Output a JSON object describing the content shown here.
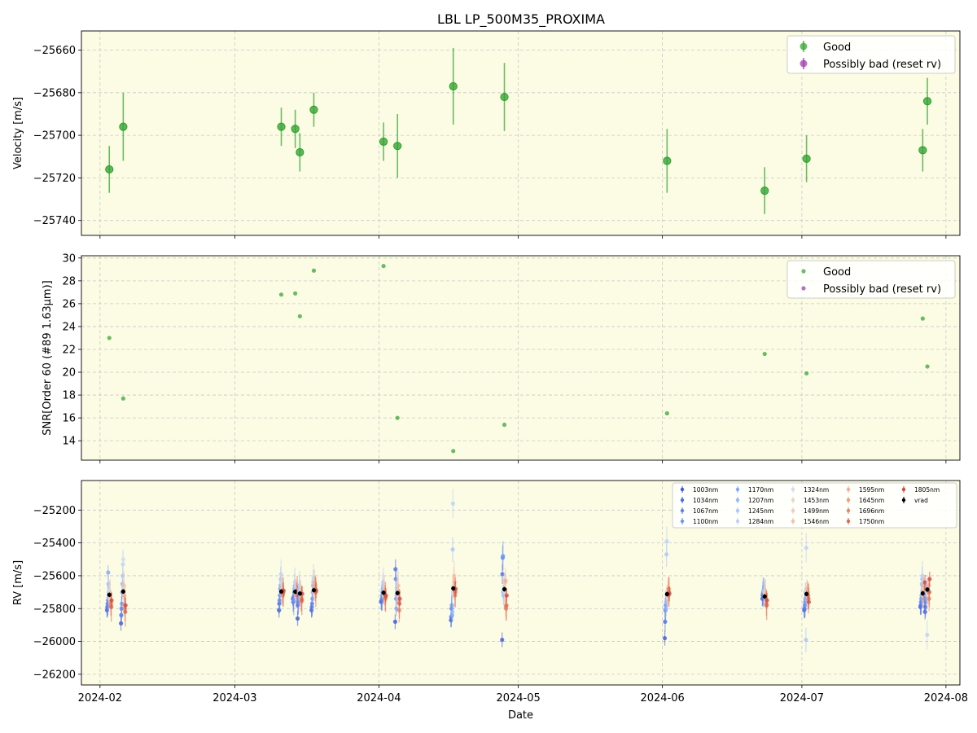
{
  "title": "LBL LP_500M35_PROXIMA",
  "colors": {
    "good": "#2ca02c",
    "bad": "#9b30b0",
    "panel_bg": "#fcfce4",
    "grid": "#c8c8c8"
  },
  "chart_data": [
    {
      "type": "scatter",
      "panel": "velocity",
      "ylabel": "Velocity [m/s]",
      "ylim": [
        -25747,
        -25651
      ],
      "yticks": [
        -25660,
        -25680,
        -25700,
        -25720,
        -25740
      ],
      "ytick_labels": [
        "−25660",
        "−25680",
        "−25700",
        "−25720",
        "−25740"
      ],
      "legend": [
        "Good",
        "Possibly bad (reset rv)"
      ],
      "legend_position": "top-right",
      "grid": true,
      "series": [
        {
          "name": "Good",
          "points": [
            {
              "x": "2024-02-03",
              "y": -25716,
              "err": 11
            },
            {
              "x": "2024-02-06",
              "y": -25696,
              "err": 16
            },
            {
              "x": "2024-03-11",
              "y": -25696,
              "err": 9
            },
            {
              "x": "2024-03-14",
              "y": -25697,
              "err": 9
            },
            {
              "x": "2024-03-15",
              "y": -25708,
              "err": 9
            },
            {
              "x": "2024-03-18",
              "y": -25688,
              "err": 8
            },
            {
              "x": "2024-04-02",
              "y": -25703,
              "err": 9
            },
            {
              "x": "2024-04-05",
              "y": -25705,
              "err": 15
            },
            {
              "x": "2024-04-17",
              "y": -25677,
              "err": 18
            },
            {
              "x": "2024-04-28",
              "y": -25682,
              "err": 16
            },
            {
              "x": "2024-06-02",
              "y": -25712,
              "err": 15
            },
            {
              "x": "2024-06-23",
              "y": -25726,
              "err": 11
            },
            {
              "x": "2024-07-02",
              "y": -25711,
              "err": 11
            },
            {
              "x": "2024-07-27",
              "y": -25707,
              "err": 10
            },
            {
              "x": "2024-07-28",
              "y": -25684,
              "err": 11
            }
          ]
        },
        {
          "name": "Possibly bad (reset rv)",
          "points": []
        }
      ]
    },
    {
      "type": "scatter",
      "panel": "snr",
      "ylabel": "SNR[Order 60 (#89 1.63μm)]",
      "ylim": [
        12.3,
        30.2
      ],
      "yticks": [
        14,
        16,
        18,
        20,
        22,
        24,
        26,
        28,
        30
      ],
      "ytick_labels": [
        "14",
        "16",
        "18",
        "20",
        "22",
        "24",
        "26",
        "28",
        "30"
      ],
      "legend": [
        "Good",
        "Possibly bad (reset rv)"
      ],
      "legend_position": "top-right",
      "grid": true,
      "series": [
        {
          "name": "Good",
          "points": [
            {
              "x": "2024-02-03",
              "y": 23.0
            },
            {
              "x": "2024-02-06",
              "y": 17.7
            },
            {
              "x": "2024-03-11",
              "y": 26.8
            },
            {
              "x": "2024-03-14",
              "y": 26.9
            },
            {
              "x": "2024-03-15",
              "y": 24.9
            },
            {
              "x": "2024-03-18",
              "y": 28.9
            },
            {
              "x": "2024-04-02",
              "y": 29.3
            },
            {
              "x": "2024-04-05",
              "y": 16.0
            },
            {
              "x": "2024-04-17",
              "y": 13.1
            },
            {
              "x": "2024-04-28",
              "y": 15.4
            },
            {
              "x": "2024-06-02",
              "y": 16.4
            },
            {
              "x": "2024-06-23",
              "y": 21.6
            },
            {
              "x": "2024-07-02",
              "y": 19.9
            },
            {
              "x": "2024-07-27",
              "y": 24.7
            },
            {
              "x": "2024-07-28",
              "y": 20.5
            }
          ]
        },
        {
          "name": "Possibly bad (reset rv)",
          "points": []
        }
      ]
    },
    {
      "type": "scatter",
      "panel": "rv",
      "ylabel": "RV [m/s]",
      "xlabel": "Date",
      "ylim": [
        -26265,
        -25020
      ],
      "yticks": [
        -25200,
        -25400,
        -25600,
        -25800,
        -26000,
        -26200
      ],
      "ytick_labels": [
        "−25200",
        "−25400",
        "−25600",
        "−25800",
        "−26000",
        "−26200"
      ],
      "xticks": [
        "2024-02-01",
        "2024-03-01",
        "2024-04-01",
        "2024-05-01",
        "2024-06-01",
        "2024-07-01",
        "2024-08-01"
      ],
      "xtick_labels": [
        "2024-02",
        "2024-03",
        "2024-04",
        "2024-05",
        "2024-06",
        "2024-07",
        "2024-08"
      ],
      "xlim": [
        "2024-01-28",
        "2024-08-04"
      ],
      "grid": true,
      "legend_position": "top-right",
      "bands": [
        {
          "name": "1003nm",
          "color": "#3d5ad8"
        },
        {
          "name": "1034nm",
          "color": "#4b6ee6"
        },
        {
          "name": "1067nm",
          "color": "#5b82f0"
        },
        {
          "name": "1100nm",
          "color": "#6e96f8"
        },
        {
          "name": "1170nm",
          "color": "#82a8fc"
        },
        {
          "name": "1207nm",
          "color": "#96b8fd"
        },
        {
          "name": "1245nm",
          "color": "#aac6fc"
        },
        {
          "name": "1284nm",
          "color": "#bed2f6"
        },
        {
          "name": "1324nm",
          "color": "#d0dcef"
        },
        {
          "name": "1453nm",
          "color": "#e6d6cc"
        },
        {
          "name": "1499nm",
          "color": "#f0cdb8"
        },
        {
          "name": "1546nm",
          "color": "#f5c0a6"
        },
        {
          "name": "1595nm",
          "color": "#f6ae90"
        },
        {
          "name": "1645nm",
          "color": "#f29a7a"
        },
        {
          "name": "1696nm",
          "color": "#e98466"
        },
        {
          "name": "1750nm",
          "color": "#de6a52"
        },
        {
          "name": "1805nm",
          "color": "#cf4a40"
        }
      ],
      "vrad_label": "vrad",
      "vrad": [
        {
          "x": "2024-02-03",
          "y": -25716
        },
        {
          "x": "2024-02-06",
          "y": -25696
        },
        {
          "x": "2024-03-11",
          "y": -25696
        },
        {
          "x": "2024-03-14",
          "y": -25697
        },
        {
          "x": "2024-03-15",
          "y": -25708
        },
        {
          "x": "2024-03-18",
          "y": -25688
        },
        {
          "x": "2024-04-02",
          "y": -25703
        },
        {
          "x": "2024-04-05",
          "y": -25705
        },
        {
          "x": "2024-04-17",
          "y": -25677
        },
        {
          "x": "2024-04-28",
          "y": -25682
        },
        {
          "x": "2024-06-02",
          "y": -25712
        },
        {
          "x": "2024-06-23",
          "y": -25726
        },
        {
          "x": "2024-07-02",
          "y": -25711
        },
        {
          "x": "2024-07-27",
          "y": -25707
        },
        {
          "x": "2024-07-28",
          "y": -25684
        }
      ],
      "band_values": [
        [
          -25810,
          -25790,
          -25770,
          -25750,
          -25580,
          -25650,
          -25700,
          -25720,
          -25690,
          -25740,
          -25720,
          -25710,
          -25760,
          -25780,
          -25770,
          -25790,
          -25750
        ],
        [
          -25890,
          -25840,
          -25800,
          -25770,
          -25700,
          -25650,
          -25600,
          -25530,
          -25500,
          -25680,
          -25700,
          -25660,
          -25720,
          -25780,
          -25800,
          -25820,
          -25780
        ],
        [
          -25810,
          -25770,
          -25750,
          -25720,
          -25680,
          -25660,
          -25620,
          -25590,
          -25640,
          -25700,
          -25690,
          -25680,
          -25700,
          -25720,
          -25710,
          -25700,
          -25690
        ],
        [
          -25740,
          -25760,
          -25730,
          -25750,
          -25700,
          -25680,
          -25660,
          -25640,
          -25700,
          -25690,
          -25700,
          -25710,
          -25690,
          -25700,
          -25720,
          -25690,
          -25700
        ],
        [
          -25860,
          -25780,
          -25760,
          -25740,
          -25700,
          -25690,
          -25680,
          -25660,
          -25700,
          -25710,
          -25700,
          -25720,
          -25730,
          -25760,
          -25740,
          -25750,
          -25710
        ],
        [
          -25810,
          -25790,
          -25770,
          -25740,
          -25700,
          -25660,
          -25640,
          -25620,
          -25690,
          -25700,
          -25680,
          -25650,
          -25640,
          -25660,
          -25680,
          -25700,
          -25690
        ],
        [
          -25760,
          -25750,
          -25740,
          -25720,
          -25700,
          -25680,
          -25660,
          -25640,
          -25700,
          -25720,
          -25710,
          -25690,
          -25700,
          -25720,
          -25740,
          -25730,
          -25720
        ],
        [
          -25880,
          -25560,
          -25620,
          -25740,
          -25800,
          -25720,
          -25690,
          -25660,
          -25700,
          -25710,
          -25690,
          -25660,
          -25700,
          -25760,
          -25810,
          -25770,
          -25740
        ],
        [
          -25870,
          -25850,
          -25800,
          -25780,
          -25840,
          -25820,
          -25440,
          -25160,
          -25700,
          -25660,
          -25620,
          -25600,
          -25640,
          -25690,
          -25720,
          -25700,
          -25680
        ],
        [
          -25990,
          -25590,
          -25490,
          -25480,
          -25700,
          -25720,
          -25690,
          -25680,
          -25700,
          -25750,
          -25690,
          -25640,
          -25630,
          -25790,
          -25800,
          -25780,
          -25720
        ],
        [
          -25980,
          -25880,
          -25810,
          -25780,
          -25800,
          -25760,
          -25470,
          -25390,
          -25700,
          -25720,
          -25730,
          -25700,
          -25680,
          -25720,
          -25680,
          -25700,
          -25710
        ],
        [
          -25740,
          -25720,
          -25710,
          -25700,
          -25690,
          -25680,
          -25690,
          -25700,
          -25720,
          -25710,
          -25700,
          -25710,
          -25720,
          -25740,
          -25770,
          -25780,
          -25750
        ],
        [
          -25810,
          -25800,
          -25780,
          -25760,
          -25740,
          -25700,
          -25990,
          -25430,
          -25700,
          -25680,
          -25700,
          -25720,
          -25680,
          -25700,
          -25720,
          -25740,
          -25760
        ],
        [
          -25790,
          -25780,
          -25760,
          -25740,
          -25720,
          -25650,
          -25620,
          -25600,
          -25700,
          -25720,
          -25680,
          -25700,
          -25660,
          -25700,
          -25740,
          -25720,
          -25640
        ],
        [
          -25820,
          -25790,
          -25760,
          -25740,
          -25720,
          -25700,
          -25690,
          -25960,
          -25700,
          -25720,
          -25700,
          -25690,
          -25660,
          -25700,
          -25740,
          -25700,
          -25620
        ]
      ]
    }
  ]
}
